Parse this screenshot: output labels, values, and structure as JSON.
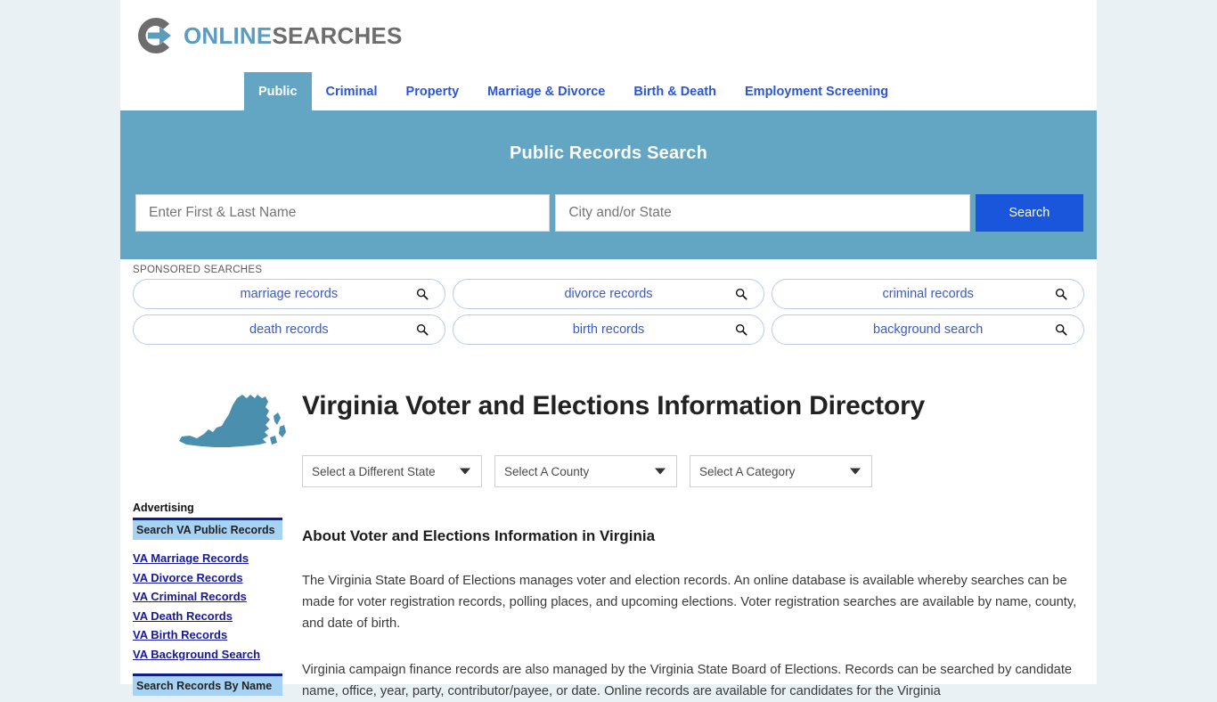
{
  "brand": {
    "logo_icon": "circle-arrow-logo-icon",
    "name_part1": "ONLINE",
    "name_part2": "SEARCHES",
    "accent_blue": "#5b9dbf",
    "accent_gray": "#6d6d6d"
  },
  "nav": {
    "items": [
      {
        "label": "Public",
        "active": true
      },
      {
        "label": "Criminal",
        "active": false
      },
      {
        "label": "Property",
        "active": false
      },
      {
        "label": "Marriage & Divorce",
        "active": false
      },
      {
        "label": "Birth & Death",
        "active": false
      },
      {
        "label": "Employment Screening",
        "active": false
      }
    ]
  },
  "hero": {
    "title": "Public Records Search",
    "name_placeholder": "Enter First & Last Name",
    "name_value": "",
    "city_placeholder": "City and/or State",
    "city_value": "",
    "search_label": "Search",
    "bg_color": "#63a6c4",
    "button_color": "#1a56db"
  },
  "sponsored": {
    "label": "SPONSORED SEARCHES",
    "icon": "magnifier-icon",
    "row1": [
      "marriage records",
      "divorce records",
      "criminal records"
    ],
    "row2": [
      "death records",
      "birth records",
      "background search"
    ]
  },
  "sidebar": {
    "state_map_icon": "virginia-state-map-icon",
    "advertising_label": "Advertising",
    "head1": "Search VA Public Records",
    "links": [
      "VA Marriage Records",
      "VA Divorce Records",
      "VA Criminal Records",
      "VA Death Records",
      "VA Birth Records",
      "VA Background Search"
    ],
    "head2": "Search Records By Name"
  },
  "main": {
    "page_title": "Virginia Voter and Elections Information Directory",
    "selects": [
      {
        "label": "Select a Different State"
      },
      {
        "label": "Select A County"
      },
      {
        "label": "Select A Category"
      }
    ],
    "about_heading": "About Voter and Elections Information in Virginia",
    "paragraph1": "The Virginia State Board of Elections manages voter and election records. An online database is available whereby searches can be made for voter registration records, polling places, and upcoming elections. Voter registration searches are available by name, county, and date of birth.",
    "paragraph2": "Virginia campaign finance records are also managed by the Virginia State Board of Elections. Records can be searched by candidate name, office, year, party, contributor/payee, or date. Online records are available for candidates for the Virginia"
  }
}
